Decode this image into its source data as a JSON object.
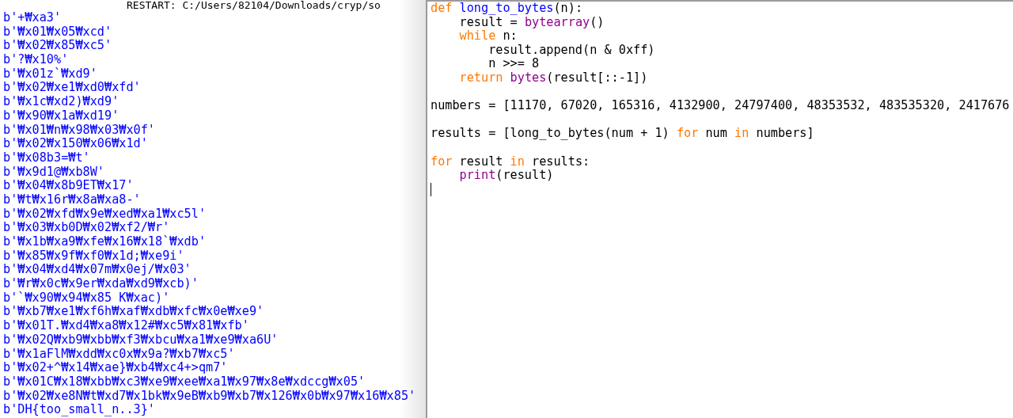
{
  "shell": {
    "header": "RESTART: C:/Users/82104/Downloads/cryp/so",
    "output": [
      "b'+₩xa3'",
      "b'₩x01₩x05₩xcd'",
      "b'₩x02₩x85₩xc5'",
      "b'?₩x10%'",
      "b'₩x01z`₩xd9'",
      "b'₩x02₩xe1₩xd0₩xfd'",
      "b'₩x1c₩xd2)₩xd9'",
      "b'₩x90₩x1a₩xd19'",
      "b'₩x01₩n₩x98₩x03₩x0f'",
      "b'₩x02₩x150₩x06₩x1d'",
      "b'₩x08b3=₩t'",
      "b'₩x9d1@₩xb8W'",
      "b'₩x04₩x8b9ET₩x17'",
      "b'₩t₩x16r₩x8a₩xa8-'",
      "b'₩x02₩xfd₩x9e₩xed₩xa1₩xc5l'",
      "b'₩x03₩xb0D₩x02₩xf2/₩r'",
      "b'₩x1b₩xa9₩xfe₩x16₩x18`₩xdb'",
      "b'₩x85₩x9f₩xf0₩x1d;₩xe9i'",
      "b'₩x04₩xd4₩x07m₩x0ej/₩x03'",
      "b'₩r₩x0c₩x9er₩xda₩xd9₩xcb)'",
      "b'`₩x90₩x94₩x85 K₩xac)'",
      "b'₩xb7₩xe1₩xf6h₩xaf₩xdb₩xfc₩x0e₩xe9'",
      "b'₩x01T.₩xd4₩xa8₩x12#₩xc5₩x81₩xfb'",
      "b'₩x02Q₩xb9₩xbb₩xf3₩xbcu₩xa1₩xe9₩xa6U'",
      "b'₩x1aFlM₩xdd₩xc0x₩x9a?₩xb7₩xc5'",
      "b'₩x02+^₩x14₩xae}₩xb4₩xc4+>qm7'",
      "b'₩x01C₩x18₩xbb₩xc3₩xe9₩xee₩xa1₩x97₩x8e₩xdccg₩x05'",
      "b'₩x02₩xe8N₩t₩xd7₩x1bk₩x9eB₩xb9₩xb7₩x126₩x0b₩x97₩x16₩x85'",
      "b'DH{too_small_n..3}'"
    ]
  },
  "editor": {
    "blocks": [
      [
        [
          {
            "text": "def ",
            "kind": "keyword"
          },
          {
            "text": "long_to_bytes",
            "kind": "definition"
          },
          {
            "text": "(n):",
            "kind": "plain"
          }
        ],
        [
          {
            "text": "    result = ",
            "kind": "plain"
          },
          {
            "text": "bytearray",
            "kind": "builtin"
          },
          {
            "text": "()",
            "kind": "plain"
          }
        ],
        [
          {
            "text": "    while",
            "kind": "keyword"
          },
          {
            "text": " n:",
            "kind": "plain"
          }
        ],
        [
          {
            "text": "        result.append(n & 0xff)",
            "kind": "plain"
          }
        ],
        [
          {
            "text": "        n >>= 8",
            "kind": "plain"
          }
        ],
        [
          {
            "text": "    return ",
            "kind": "keyword"
          },
          {
            "text": "bytes",
            "kind": "builtin"
          },
          {
            "text": "(result[::-1])",
            "kind": "plain"
          }
        ]
      ],
      [
        [
          {
            "text": "numbers = [11170, 67020, 165316, 4132900, 24797400, 48353532, 483535320, 2417676",
            "kind": "plain"
          }
        ]
      ],
      [
        [
          {
            "text": "results = [long_to_bytes(num + 1) ",
            "kind": "plain"
          },
          {
            "text": "for",
            "kind": "keyword"
          },
          {
            "text": " num ",
            "kind": "plain"
          },
          {
            "text": "in",
            "kind": "keyword"
          },
          {
            "text": " numbers]",
            "kind": "plain"
          }
        ]
      ],
      [
        [
          {
            "text": "for",
            "kind": "keyword"
          },
          {
            "text": " result ",
            "kind": "plain"
          },
          {
            "text": "in",
            "kind": "keyword"
          },
          {
            "text": " results:",
            "kind": "plain"
          }
        ],
        [
          {
            "text": "    print",
            "kind": "builtin"
          },
          {
            "text": "(result)",
            "kind": "plain"
          }
        ]
      ]
    ]
  }
}
